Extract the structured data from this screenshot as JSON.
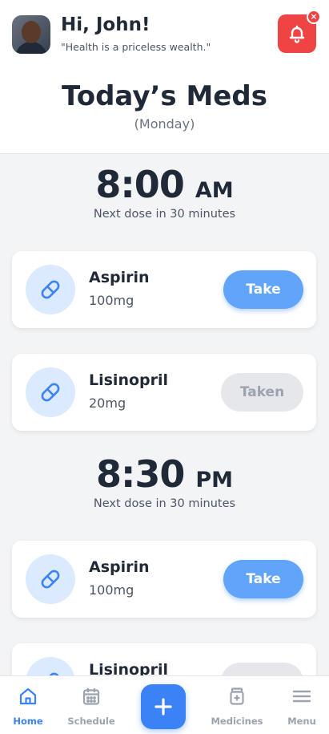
{
  "header": {
    "greeting": "Hi, John!",
    "quote": "\"Health is a priceless wealth.\"",
    "notification_badge": "×"
  },
  "page": {
    "title": "Today’s Meds",
    "subtitle": "(Monday)"
  },
  "schedule": [
    {
      "time": "8:00",
      "ampm": "AM",
      "next_dose": "Next dose in 30 minutes",
      "meds": [
        {
          "name": "Aspirin",
          "dose": "100mg",
          "action": "Take",
          "status": "pending"
        },
        {
          "name": "Lisinopril",
          "dose": "20mg",
          "action": "Taken",
          "status": "taken"
        }
      ]
    },
    {
      "time": "8:30",
      "ampm": "PM",
      "next_dose": "Next dose in 30 minutes",
      "meds": [
        {
          "name": "Aspirin",
          "dose": "100mg",
          "action": "Take",
          "status": "pending"
        },
        {
          "name": "Lisinopril",
          "dose": "",
          "action": "",
          "status": "taken"
        }
      ]
    }
  ],
  "nav": {
    "home": "Home",
    "schedule": "Schedule",
    "medicines": "Medicines",
    "menu": "Menu"
  },
  "colors": {
    "accent": "#3b82f6",
    "accent_light": "#60a5fa",
    "alert": "#ef4444",
    "icon_bg": "#dbeafe"
  }
}
